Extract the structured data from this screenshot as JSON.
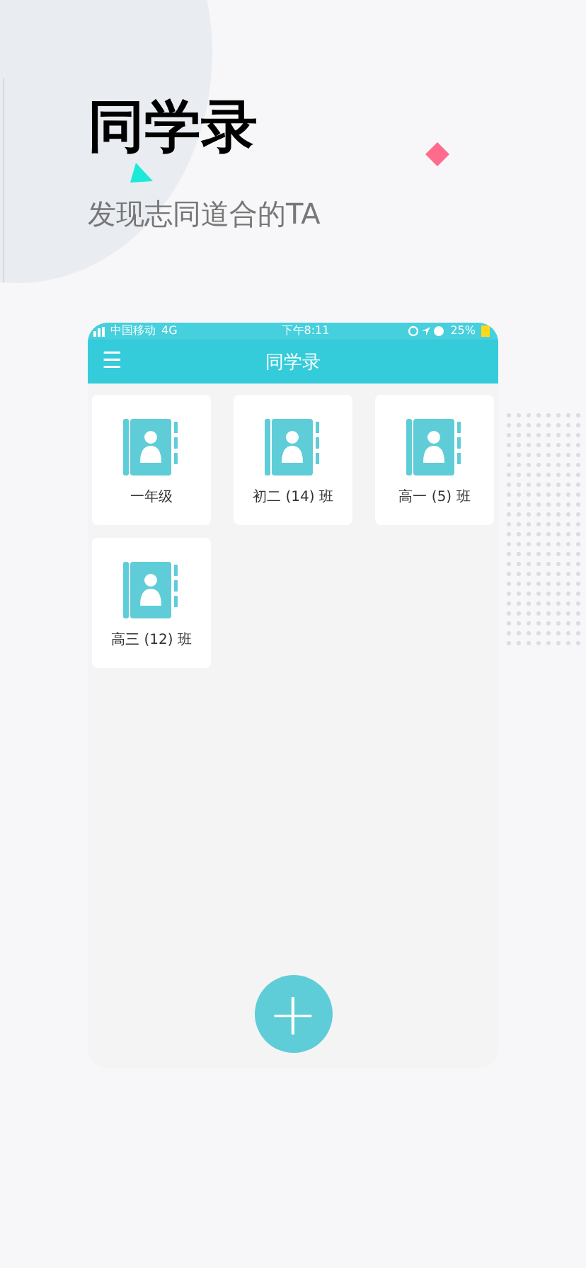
{
  "headline": "同学录",
  "subtitle": "发现志同道合的TA",
  "status_bar": {
    "carrier": "中国移动",
    "network": "4G",
    "time": "下午8:11",
    "battery": "25%"
  },
  "nav_bar": {
    "title": "同学录",
    "menu_icon": "☰"
  },
  "classes": [
    {
      "name": "一年级"
    },
    {
      "name": "初二 (14) 班"
    },
    {
      "name": "高一 (5) 班"
    },
    {
      "name": "高三 (12) 班"
    }
  ],
  "add_button": {
    "label": "+"
  }
}
